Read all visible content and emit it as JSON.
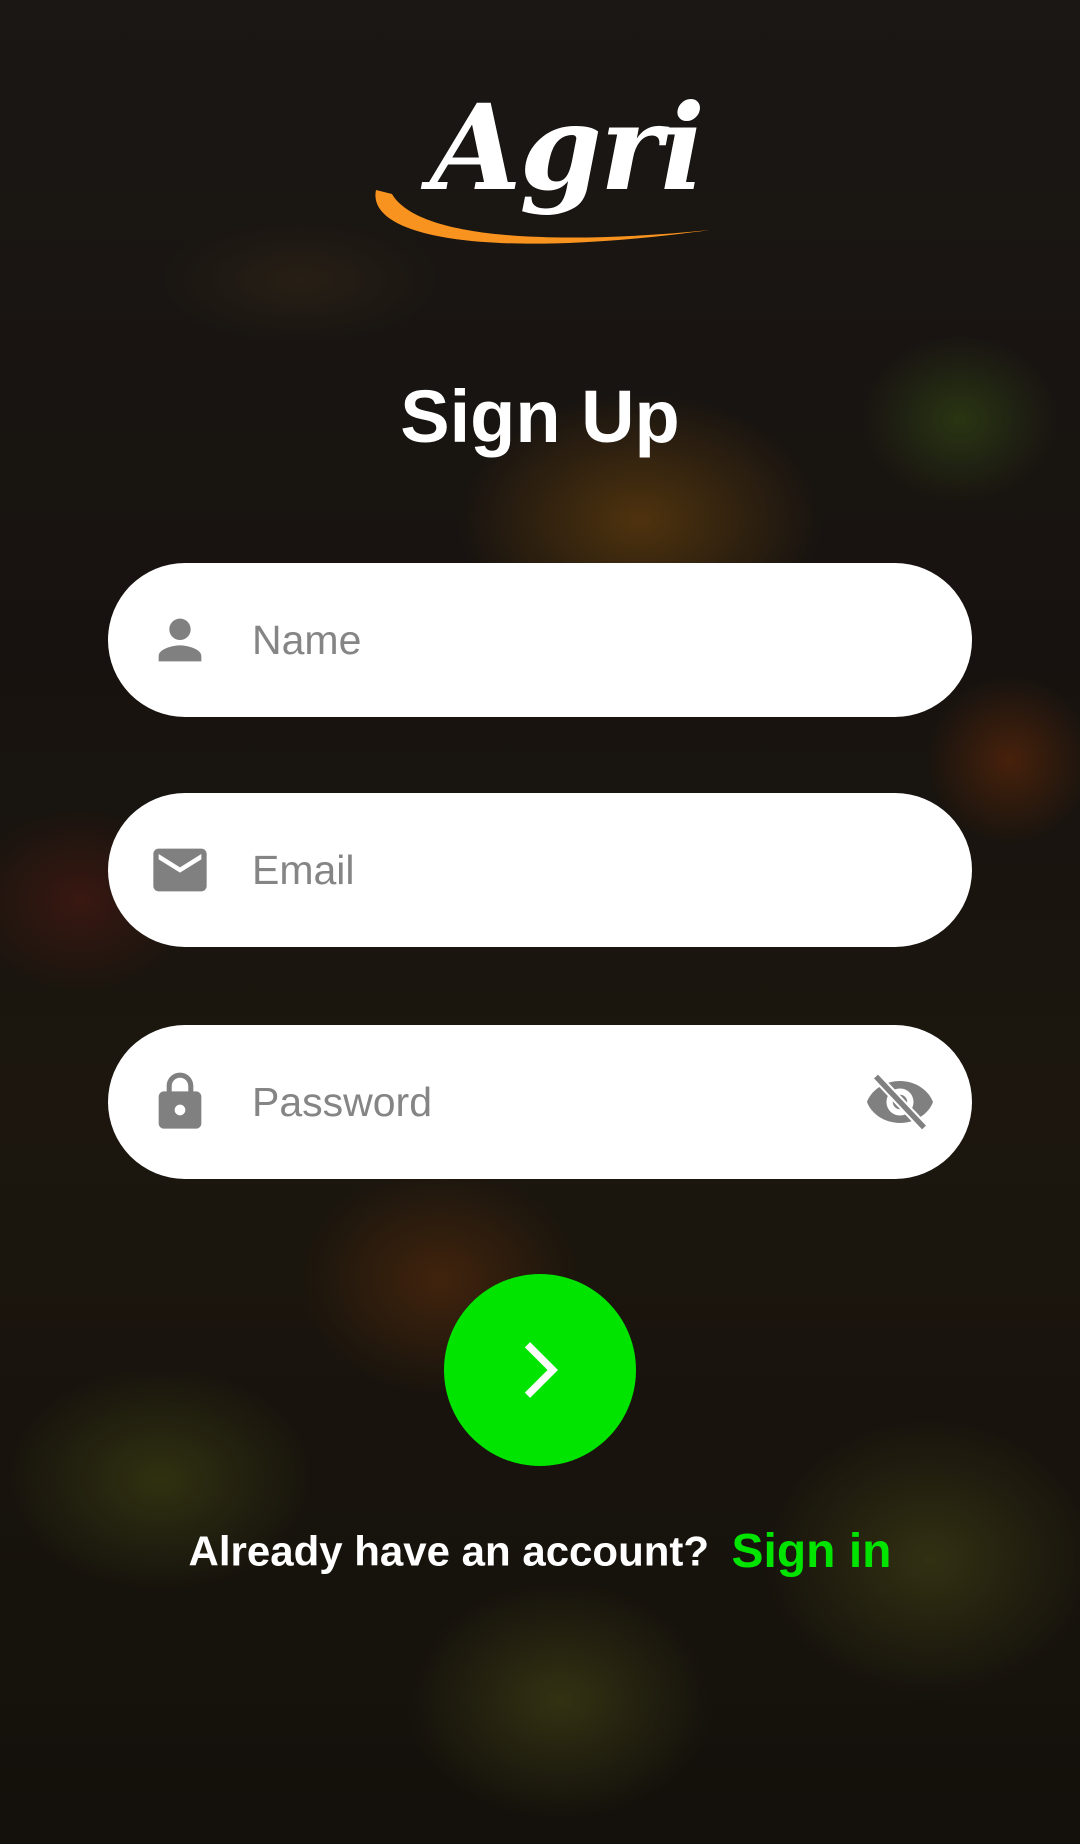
{
  "brand": {
    "logo_text": "Agri",
    "swoosh_color": "#f7931e"
  },
  "title": "Sign Up",
  "form": {
    "name": {
      "placeholder": "Name",
      "value": "",
      "icon": "person-icon"
    },
    "email": {
      "placeholder": "Email",
      "value": "",
      "icon": "mail-icon"
    },
    "password": {
      "placeholder": "Password",
      "value": "",
      "icon": "lock-icon",
      "toggle_icon": "visibility-off-icon"
    },
    "submit_icon": "chevron-right-icon"
  },
  "footer": {
    "question": "Already have an account?",
    "link": "Sign in"
  },
  "colors": {
    "accent": "#00e400",
    "field_bg": "#ffffff",
    "icon_gray": "#808080"
  }
}
